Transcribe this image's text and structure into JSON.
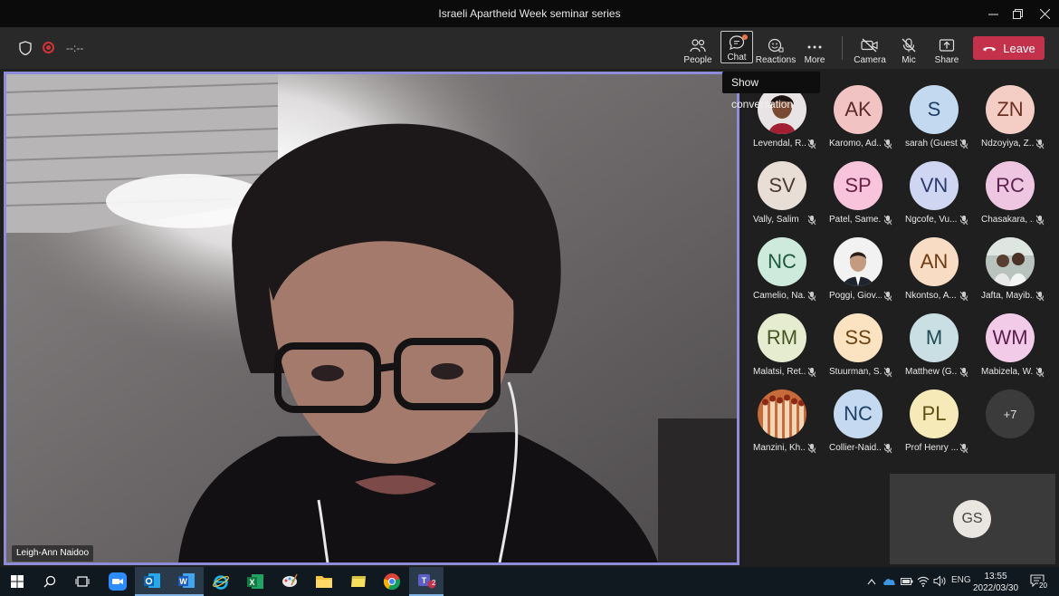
{
  "window": {
    "title": "Israeli Apartheid Week seminar series"
  },
  "toolbar": {
    "timer": "--:--",
    "buttons": [
      {
        "label": "People"
      },
      {
        "label": "Chat"
      },
      {
        "label": "Reactions"
      },
      {
        "label": "More"
      },
      {
        "label": "Camera"
      },
      {
        "label": "Mic"
      },
      {
        "label": "Share"
      }
    ],
    "leave_label": "Leave"
  },
  "tooltip": "Show conversation",
  "main_video": {
    "speaker": "Leigh-Ann Naidoo"
  },
  "participants": [
    {
      "initials": "",
      "name": "Levendal, R...",
      "photo": true
    },
    {
      "initials": "AK",
      "name": "Karomo, Ad..."
    },
    {
      "initials": "S",
      "name": "sarah (Guest)"
    },
    {
      "initials": "ZN",
      "name": "Ndzoyiya, Z..."
    },
    {
      "initials": "SV",
      "name": "Vally, Salim"
    },
    {
      "initials": "SP",
      "name": "Patel, Same..."
    },
    {
      "initials": "VN",
      "name": "Ngcofe, Vu..."
    },
    {
      "initials": "RC",
      "name": "Chasakara, ..."
    },
    {
      "initials": "NC",
      "name": "Camelio, Na..."
    },
    {
      "initials": "",
      "name": "Poggi, Giov...",
      "photo": true
    },
    {
      "initials": "AN",
      "name": "Nkontso, A..."
    },
    {
      "initials": "",
      "name": "Jafta, Mayib...",
      "photo": true
    },
    {
      "initials": "RM",
      "name": "Malatsi, Ret..."
    },
    {
      "initials": "SS",
      "name": "Stuurman, S..."
    },
    {
      "initials": "M",
      "name": "Matthew (G..."
    },
    {
      "initials": "WM",
      "name": "Mabizela, W..."
    },
    {
      "initials": "",
      "name": "Manzini, Kh...",
      "photo": true
    },
    {
      "initials": "NC",
      "name": "Collier-Naid..."
    },
    {
      "initials": "PL",
      "name": "Prof Henry ..."
    }
  ],
  "overflow_count": "+7",
  "self_view": {
    "initials": "GS"
  },
  "taskbar": {
    "language": "ENG",
    "time": "13:55",
    "date": "2022/03/30",
    "notifications": "20",
    "teams_badge": "2"
  }
}
